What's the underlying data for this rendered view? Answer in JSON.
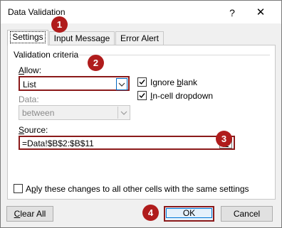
{
  "window": {
    "title": "Data Validation",
    "help_glyph": "?",
    "close_glyph": "✕"
  },
  "tabs": [
    {
      "label": "Settings"
    },
    {
      "label": "Input Message"
    },
    {
      "label": "Error Alert"
    }
  ],
  "settings": {
    "group_title": "Validation criteria",
    "allow": {
      "label_prefix": "",
      "label_key": "A",
      "label_rest": "llow:",
      "value": "List"
    },
    "data": {
      "label": "Data:",
      "value": "between"
    },
    "ignore_blank": {
      "label_key": "b",
      "label_pre": "Ignore ",
      "label_post": "lank",
      "checked": true
    },
    "in_cell_dropdown": {
      "label_key": "I",
      "label_rest": "n-cell dropdown",
      "checked": true
    },
    "source": {
      "label_key": "S",
      "label_rest": "ource:",
      "value": "=Data!$B$2:$B$11"
    },
    "apply_all": {
      "label_pre": "Ap",
      "label_key": "p",
      "label_rest": "ly these changes to all other cells with the same settings",
      "checked": false
    }
  },
  "buttons": {
    "clear_all": {
      "label_key": "C",
      "label_rest": "lear All"
    },
    "ok": "OK",
    "cancel": "Cancel"
  },
  "annotations": [
    "1",
    "2",
    "3",
    "4"
  ],
  "colors": {
    "annotation_red": "#b01c1c",
    "highlight_border": "#8b1a1a",
    "focus_blue": "#0078d7"
  }
}
